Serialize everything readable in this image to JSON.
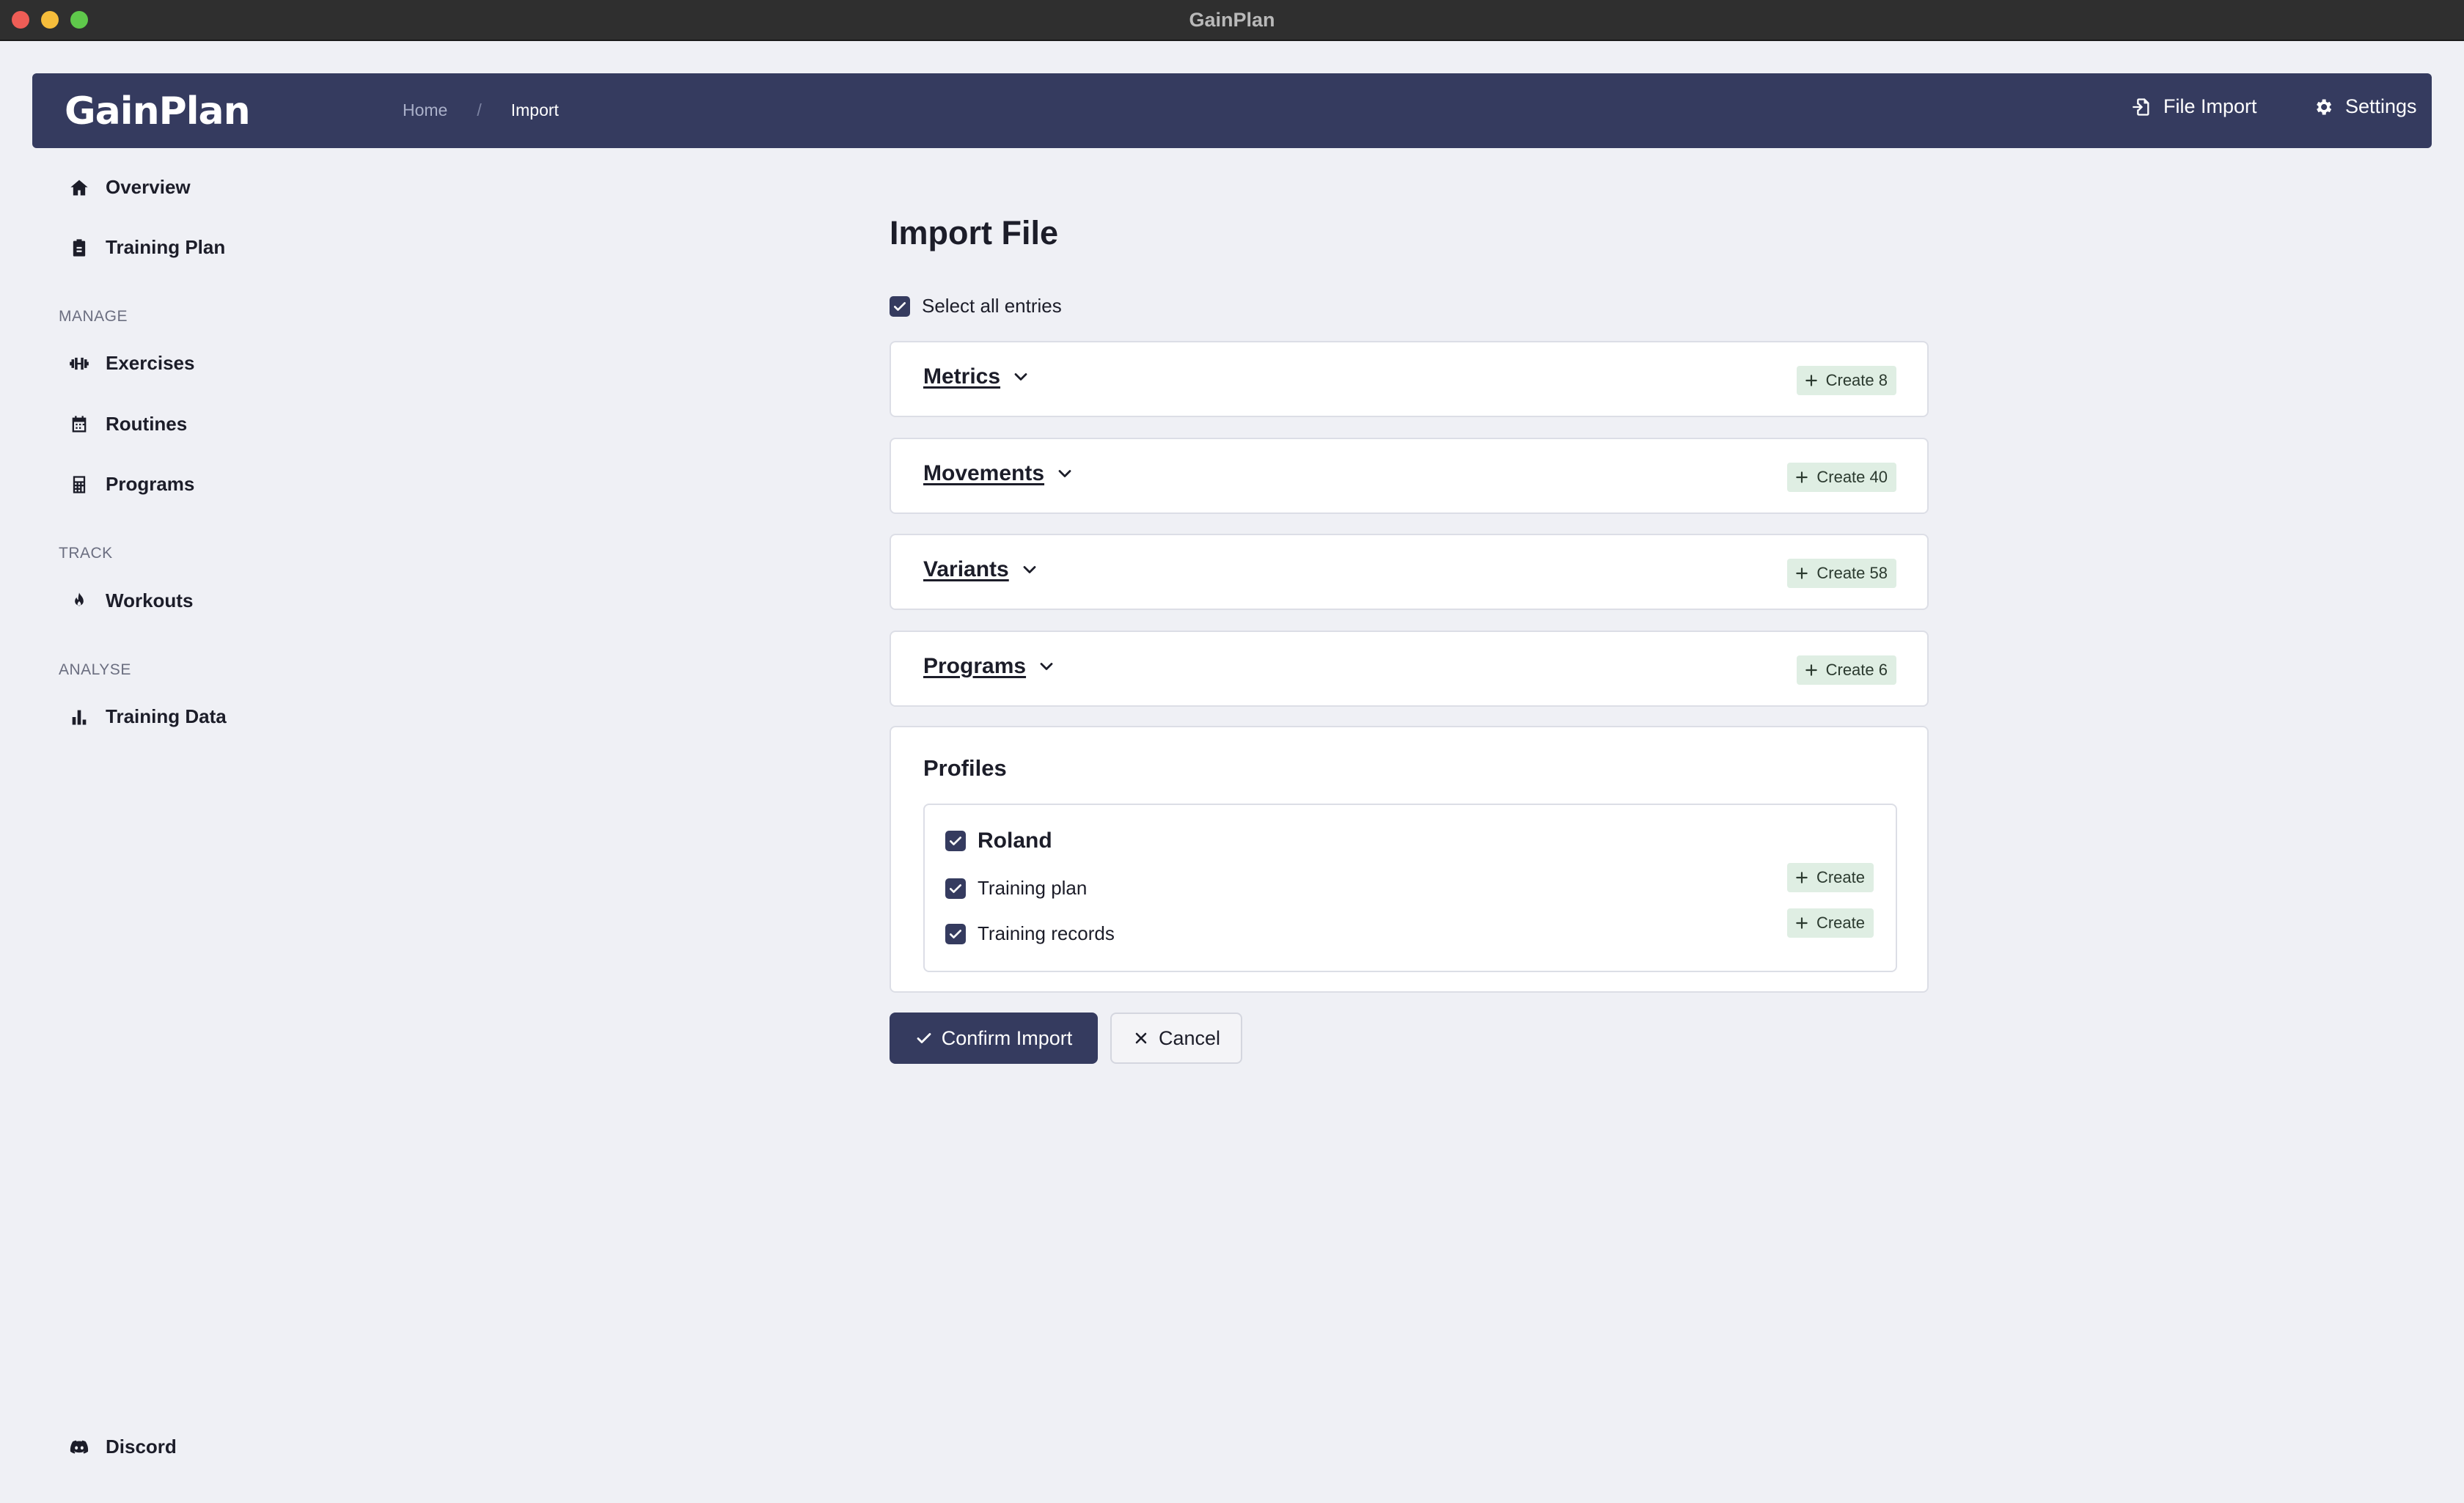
{
  "window": {
    "title": "GainPlan"
  },
  "header": {
    "logo": "GainPlan",
    "breadcrumb": {
      "home": "Home",
      "separator": "/",
      "current": "Import"
    },
    "file_import_label": "File Import",
    "settings_label": "Settings"
  },
  "sidebar": {
    "overview": "Overview",
    "training_plan": "Training Plan",
    "manage_heading": "MANAGE",
    "exercises": "Exercises",
    "routines": "Routines",
    "programs": "Programs",
    "track_heading": "TRACK",
    "workouts": "Workouts",
    "analyse_heading": "ANALYSE",
    "training_data": "Training Data",
    "discord": "Discord"
  },
  "main": {
    "title": "Import File",
    "select_all_label": "Select all entries",
    "select_all_checked": true,
    "sections": [
      {
        "label": "Metrics",
        "create_label": "Create 8"
      },
      {
        "label": "Movements",
        "create_label": "Create 40"
      },
      {
        "label": "Variants",
        "create_label": "Create 58"
      },
      {
        "label": "Programs",
        "create_label": "Create 6"
      }
    ],
    "profiles": {
      "title": "Profiles",
      "name": "Roland",
      "rows": [
        {
          "label": "Training plan",
          "create_label": "Create"
        },
        {
          "label": "Training records",
          "create_label": "Create"
        }
      ]
    },
    "confirm_label": "Confirm Import",
    "cancel_label": "Cancel"
  },
  "colors": {
    "header_bg": "#353b5f",
    "page_bg": "#eff0f5",
    "badge_bg": "#dfeee3",
    "accent": "#353b5f"
  }
}
